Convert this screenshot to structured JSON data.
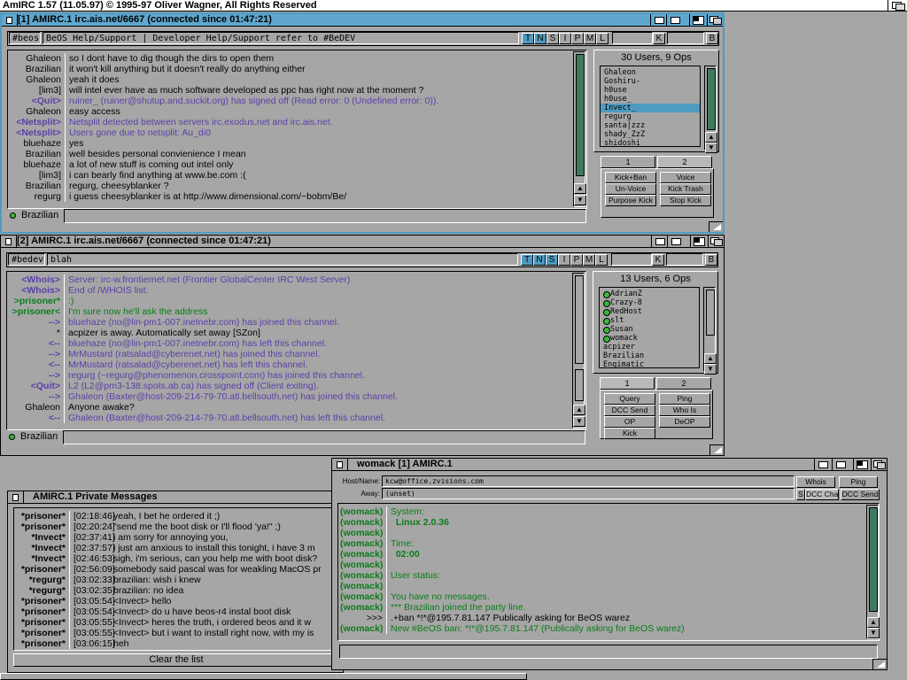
{
  "screen": {
    "title": "AmIRC 1.57 (11.05.97) © 1995-97 Oliver Wagner, All Rights Reserved"
  },
  "window1": {
    "title": "[1] AMIRC.1  irc.ais.net/6667 (connected since 01:47:21)",
    "channel": "#beos",
    "topic": "BeOS Help/Support | Developer Help/Support refer to #BeDEV",
    "modes": [
      "T",
      "N",
      "S",
      "I",
      "P",
      "M",
      "L"
    ],
    "active_modes": [
      "T",
      "N"
    ],
    "k_label": "K",
    "b_label": "B",
    "messages": [
      {
        "nick": "Ghaleon",
        "text": "so I dont have to dig though the dirs to open them",
        "style": "norm"
      },
      {
        "nick": "Brazilian",
        "text": "it won't kill anything but it doesn't really do anything either",
        "style": "norm"
      },
      {
        "nick": "Ghaleon",
        "text": "yeah it does",
        "style": "norm"
      },
      {
        "nick": "[lim3]",
        "text": "will intel ever have as much software developed as ppc has right now at the moment ?",
        "style": "norm"
      },
      {
        "nick": "<Quit>",
        "text": "ruiner_ (ruiner@shutup.and.suckit.org) has signed off (Read error: 0 (Undefined error: 0)).",
        "style": "purple"
      },
      {
        "nick": "Ghaleon",
        "text": "easy access",
        "style": "norm"
      },
      {
        "nick": "<Netsplit>",
        "text": "Netsplit detected between servers irc.exodus.net and irc.ais.net.",
        "style": "purple"
      },
      {
        "nick": "<Netsplit>",
        "text": "Users gone due to netsplit: Au_di0",
        "style": "purple"
      },
      {
        "nick": "bluehaze",
        "text": "yes",
        "style": "norm"
      },
      {
        "nick": "Brazilian",
        "text": "well besides personal convienience I mean",
        "style": "norm"
      },
      {
        "nick": "bluehaze",
        "text": "a lot of new stuff is coming out intel only",
        "style": "norm"
      },
      {
        "nick": "[lim3]",
        "text": "i can bearly find anything at www.be.com :(",
        "style": "norm"
      },
      {
        "nick": "Brazilian",
        "text": "regurg, cheesyblanker ?",
        "style": "norm"
      },
      {
        "nick": "regurg",
        "text": "i guess cheesyblanker is at http://www.dimensional.com/~bobm/Be/",
        "style": "norm"
      }
    ],
    "users_header": "30 Users, 9 Ops",
    "users": [
      "Ghaleon",
      "Goshiru-",
      "h0use",
      "h0use_",
      "Invect_",
      "regurg",
      "santa|zzz",
      "shady_ZzZ",
      "shidoshi"
    ],
    "selected_user": "Invect_",
    "tabs": [
      "1",
      "2"
    ],
    "current_tab": "2",
    "buttons": [
      "Kick+Ban",
      "Voice",
      "Un-Voice",
      "Kick Trash",
      "Purpose Kick",
      "Stop Kick"
    ],
    "my_nick": "Brazilian",
    "input_value": ""
  },
  "window2": {
    "title": "[2] AMIRC.1  irc.ais.net/6667 (connected since 01:47:21)",
    "channel": "#bedev",
    "topic": "blah",
    "modes": [
      "T",
      "N",
      "S",
      "I",
      "P",
      "M",
      "L"
    ],
    "active_modes": [
      "T",
      "N",
      "S"
    ],
    "k_label": "K",
    "b_label": "B",
    "messages": [
      {
        "nick": "<Whois>",
        "text": "Server: irc-w.frontiernet.net (Frontier GlobalCenter IRC West Server)",
        "style": "purple"
      },
      {
        "nick": "<Whois>",
        "text": "End of /WHOIS list.",
        "style": "purple"
      },
      {
        "nick": ">prisoner*",
        "text": ":)",
        "style": "green"
      },
      {
        "nick": ">prisoner<",
        "text": "I'm sure now he'll ask the address",
        "style": "green"
      },
      {
        "nick": "-->",
        "text": "bluehaze (no@lin-pm1-007.inetnebr.com) has joined this channel.",
        "style": "purple"
      },
      {
        "nick": "*",
        "text": "acpizer is away. Automatically set away [SZon]",
        "style": "norm"
      },
      {
        "nick": "<--",
        "text": "bluehaze (no@lin-pm1-007.inetnebr.com) has left this channel.",
        "style": "purple"
      },
      {
        "nick": "-->",
        "text": "MrMustard (ratsalad@cyberenet.net) has joined this channel.",
        "style": "purple"
      },
      {
        "nick": "<--",
        "text": "MrMustard (ratsalad@cyberenet.net) has left this channel.",
        "style": "purple"
      },
      {
        "nick": "-->",
        "text": "regurg (~regurg@phenomenon.crosspoint.com) has joined this channel.",
        "style": "purple"
      },
      {
        "nick": "<Quit>",
        "text": "L2 (L2@pm3-138.spots.ab.ca) has signed off (Client exiting).",
        "style": "purple"
      },
      {
        "nick": "-->",
        "text": "Ghaleon (Baxter@host-209-214-79-70.atl.bellsouth.net) has joined this channel.",
        "style": "purple"
      },
      {
        "nick": "Ghaleon",
        "text": "Anyone awake?",
        "style": "norm"
      },
      {
        "nick": "<--",
        "text": "Ghaleon (Baxter@host-209-214-79-70.atl.bellsouth.net) has left this channel.",
        "style": "purple"
      }
    ],
    "users_header": "13 Users, 6 Ops",
    "users": [
      {
        "name": "AdrianZ",
        "op": true
      },
      {
        "name": "Crazy-8",
        "op": true
      },
      {
        "name": "RedHost",
        "op": true
      },
      {
        "name": "slt",
        "op": true
      },
      {
        "name": "Susan",
        "op": true
      },
      {
        "name": "womack",
        "op": true
      },
      {
        "name": "acpizer",
        "op": false
      },
      {
        "name": "Brazilian",
        "op": false
      },
      {
        "name": "Engimatic",
        "op": false
      }
    ],
    "tabs": [
      "1",
      "2"
    ],
    "current_tab": "1",
    "buttons": [
      "Query",
      "Ping",
      "DCC Send",
      "Who Is",
      "OP",
      "DeOP",
      "Kick"
    ],
    "my_nick": "Brazilian",
    "input_value": ""
  },
  "pm_window": {
    "title": "AMIRC.1  Private Messages",
    "messages": [
      {
        "nick": "*prisoner*",
        "time": "[02:18:46]",
        "text": "yeah, I bet he ordered it ;)"
      },
      {
        "nick": "*prisoner*",
        "time": "[02:20:24]",
        "text": "\"send me the boot disk or I'll flood 'ya!\" ;)"
      },
      {
        "nick": "*Invect*",
        "time": "[02:37:41]",
        "text": "i am sorry for annoying you,"
      },
      {
        "nick": "*Invect*",
        "time": "[02:37:57]",
        "text": "i just am anxious to install this tonight, i have 3 m"
      },
      {
        "nick": "*Invect*",
        "time": "[02:46:53]",
        "text": "sigh, i'm serious, can you help me with boot disk?"
      },
      {
        "nick": "*prisoner*",
        "time": "[02:56:09]",
        "text": "somebody said pascal was for weakling MacOS pr"
      },
      {
        "nick": "*regurg*",
        "time": "[03:02:33]",
        "text": "brazilian: wish i knew"
      },
      {
        "nick": "*regurg*",
        "time": "[03:02:35]",
        "text": "brazilian: no idea"
      },
      {
        "nick": "*prisoner*",
        "time": "[03:05:54]",
        "text": "<Invect> hello"
      },
      {
        "nick": "*prisoner*",
        "time": "[03:05:54]",
        "text": "<Invect> do u have beos-r4 instal boot disk"
      },
      {
        "nick": "*prisoner*",
        "time": "[03:05:55]",
        "text": "<Invect> heres the truth, i ordered beos and it w"
      },
      {
        "nick": "*prisoner*",
        "time": "[03:05:55]",
        "text": "<Invect> but i want to install right now, with my is"
      },
      {
        "nick": "*prisoner*",
        "time": "[03:06:15]",
        "text": "heh"
      }
    ],
    "clear_button": "Clear the list"
  },
  "query_window": {
    "title": "womack [1] AMIRC.1",
    "host_label": "Host/Name:",
    "host_value": "kcw@office.zvisions.com",
    "away_label": "Away:",
    "away_value": "(unset)",
    "whois_button": "Whois",
    "ping_button": "Ping",
    "s_button": "S",
    "dcc_chat_button": "DCC Chat",
    "dcc_send_button": "DCC Send",
    "messages": [
      {
        "nick": "(womack)",
        "text": "System:",
        "style": "green"
      },
      {
        "nick": "(womack)",
        "text": "  Linux 2.0.36",
        "style": "green-b"
      },
      {
        "nick": "(womack)",
        "text": "",
        "style": "green"
      },
      {
        "nick": "(womack)",
        "text": "Time:",
        "style": "green"
      },
      {
        "nick": "(womack)",
        "text": "  02:00",
        "style": "green-b"
      },
      {
        "nick": "(womack)",
        "text": "",
        "style": "green"
      },
      {
        "nick": "(womack)",
        "text": "User status:",
        "style": "green"
      },
      {
        "nick": "(womack)",
        "text": "",
        "style": "green"
      },
      {
        "nick": "(womack)",
        "text": "You have no messages.",
        "style": "green"
      },
      {
        "nick": "(womack)",
        "text": "*** Brazilian joined the party line.",
        "style": "green"
      },
      {
        "nick": ">>>",
        "text": ".+ban *!*@195.7.81.147 Publically asking for BeOS warez",
        "style": "norm"
      },
      {
        "nick": "(womack)",
        "text": "New #BeOS ban: *!*@195.7.81.147 (Publically asking for BeOS warez)",
        "style": "green"
      }
    ],
    "input_value": ""
  },
  "colors": {
    "active_title": "#5fa7cf",
    "background": "#a6a6a6",
    "purple": "#5b3fa8",
    "green": "#0a7d18"
  }
}
